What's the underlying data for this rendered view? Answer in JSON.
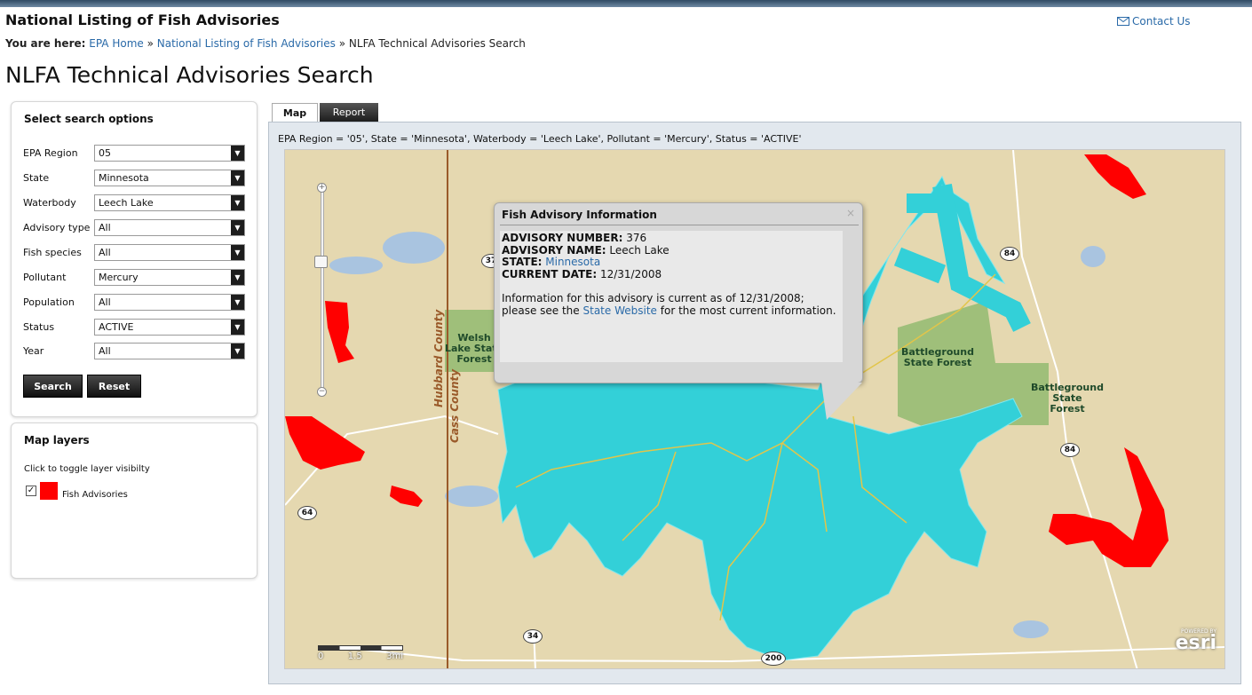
{
  "header": {
    "site_title": "National Listing of Fish Advisories",
    "contact_label": "Contact Us",
    "breadcrumb_label": "You are here:",
    "breadcrumb": [
      "EPA Home",
      "National Listing of Fish Advisories",
      "NLFA Technical Advisories Search"
    ],
    "breadcrumb_sep": "»",
    "page_title": "NLFA Technical Advisories Search"
  },
  "search": {
    "heading": "Select search options",
    "fields": [
      {
        "label": "EPA Region",
        "value": "05"
      },
      {
        "label": "State",
        "value": "Minnesota"
      },
      {
        "label": "Waterbody",
        "value": "Leech Lake"
      },
      {
        "label": "Advisory type",
        "value": "All"
      },
      {
        "label": "Fish species",
        "value": "All"
      },
      {
        "label": "Pollutant",
        "value": "Mercury"
      },
      {
        "label": "Population",
        "value": "All"
      },
      {
        "label": "Status",
        "value": "ACTIVE"
      },
      {
        "label": "Year",
        "value": "All"
      }
    ],
    "search_label": "Search",
    "reset_label": "Reset"
  },
  "layers": {
    "heading": "Map layers",
    "hint": "Click to toggle layer visibilty",
    "items": [
      {
        "name": "Fish Advisories",
        "checked": true,
        "color": "#ff0000"
      }
    ]
  },
  "tabs": [
    {
      "label": "Map",
      "active": true
    },
    {
      "label": "Report",
      "active": false
    }
  ],
  "query_text": "EPA Region = '05', State = 'Minnesota', Waterbody = 'Leech Lake', Pollutant = 'Mercury', Status = 'ACTIVE'",
  "map": {
    "water_color": "#33d0d8",
    "advisory_color": "#ff0000",
    "land_color": "#e5d8b0",
    "forest_color": "#9fbf7a",
    "labels": {
      "welsh_forest": [
        "Welsh",
        "Lake State",
        "Forest"
      ],
      "battleground_1": [
        "Battleground",
        "State Forest"
      ],
      "battleground_2": [
        "Battleground",
        "State",
        "Forest"
      ],
      "hubbard": "Hubbard County",
      "cass": "Cass County"
    },
    "shields": [
      "37",
      "84",
      "84",
      "64",
      "34",
      "200"
    ],
    "scale_ticks": [
      "0",
      "1.5",
      "3mi"
    ],
    "esri_small": "POWERED BY",
    "esri_big": "esri"
  },
  "popup": {
    "title": "Fish Advisory Information",
    "close": "×",
    "advisory_number_label": "ADVISORY NUMBER:",
    "advisory_number": "376",
    "advisory_name_label": "ADVISORY NAME:",
    "advisory_name": "Leech Lake",
    "state_label": "STATE:",
    "state": "Minnesota",
    "current_date_label": "CURRENT DATE:",
    "current_date": "12/31/2008",
    "info_line1": "Information for this advisory is current as of 12/31/2008;",
    "info_pre": "please see the",
    "info_link": "State Website",
    "info_post": "for the most current information."
  }
}
